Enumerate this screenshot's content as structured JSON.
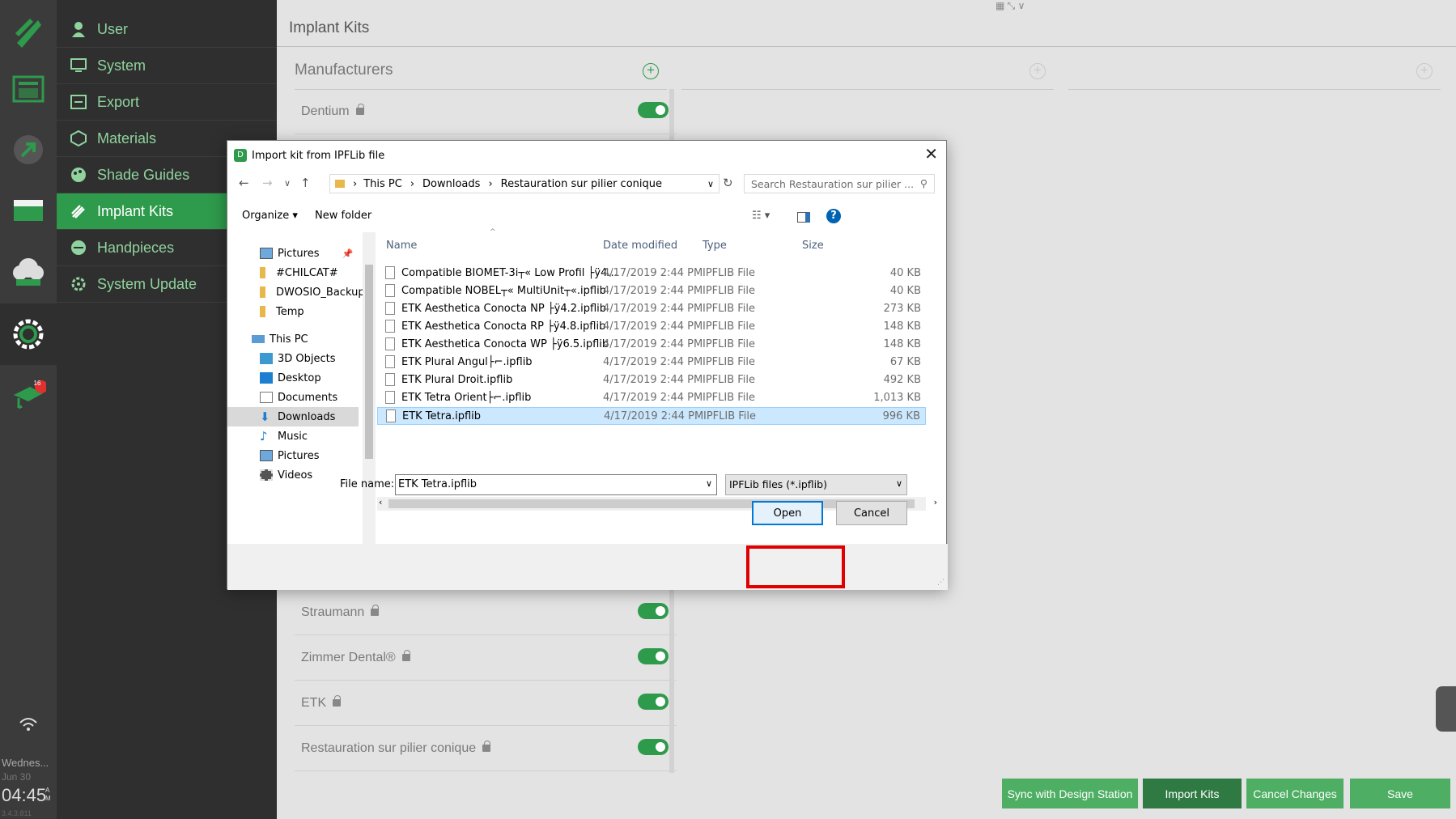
{
  "rail": {
    "day": "Wednes...",
    "date": "Jun 30",
    "time": "04:45",
    "ampm_a": "A",
    "ampm_m": "M",
    "version": "3.4.3.811",
    "badge": "16"
  },
  "nav": {
    "items": [
      {
        "label": "User",
        "icon": "user-icon"
      },
      {
        "label": "System",
        "icon": "monitor-icon"
      },
      {
        "label": "Export",
        "icon": "export-icon"
      },
      {
        "label": "Materials",
        "icon": "materials-icon"
      },
      {
        "label": "Shade Guides",
        "icon": "palette-icon"
      },
      {
        "label": "Implant Kits",
        "icon": "implant-icon",
        "active": true
      },
      {
        "label": "Handpieces",
        "icon": "handpiece-icon"
      },
      {
        "label": "System Update",
        "icon": "update-icon"
      }
    ]
  },
  "page": {
    "title": "Implant Kits",
    "manufacturers_header": "Manufacturers"
  },
  "manufacturers": [
    {
      "name": "Dentium",
      "enabled": true
    },
    {
      "name": "Straumann",
      "enabled": true
    },
    {
      "name": "Zimmer Dental®",
      "enabled": true
    },
    {
      "name": "ETK",
      "enabled": true
    },
    {
      "name": "Restauration sur pilier conique",
      "enabled": true
    }
  ],
  "buttons": {
    "sync": "Sync with Design Station",
    "import": "Import Kits",
    "cancel": "Cancel Changes",
    "save": "Save"
  },
  "dialog": {
    "title": "Import kit from IPFLib file",
    "path": [
      "This PC",
      "Downloads",
      "Restauration sur pilier conique"
    ],
    "search_placeholder": "Search Restauration sur pilier ...",
    "organize": "Organize",
    "new_folder": "New folder",
    "tree": [
      {
        "label": "Pictures",
        "type": "pictures",
        "pinned": true
      },
      {
        "label": "#CHILCAT#",
        "type": "folder"
      },
      {
        "label": "DWOSIO_Backup",
        "type": "folder"
      },
      {
        "label": "Temp",
        "type": "folder"
      },
      {
        "label": "This PC",
        "type": "pc"
      },
      {
        "label": "3D Objects",
        "type": "3d"
      },
      {
        "label": "Desktop",
        "type": "desktop"
      },
      {
        "label": "Documents",
        "type": "documents"
      },
      {
        "label": "Downloads",
        "type": "downloads",
        "selected": true
      },
      {
        "label": "Music",
        "type": "music"
      },
      {
        "label": "Pictures",
        "type": "pictures"
      },
      {
        "label": "Videos",
        "type": "videos"
      }
    ],
    "columns": [
      "Name",
      "Date modified",
      "Type",
      "Size"
    ],
    "files": [
      {
        "name": "Compatible BIOMET-3i┬« Low Profil ├ÿ4...",
        "date": "4/17/2019 2:44 PM",
        "type": "IPFLIB File",
        "size": "40 KB"
      },
      {
        "name": "Compatible NOBEL┬« MultiUnit┬«.ipflib",
        "date": "4/17/2019 2:44 PM",
        "type": "IPFLIB File",
        "size": "40 KB"
      },
      {
        "name": "ETK Aesthetica Conocta NP ├ÿ4.2.ipflib",
        "date": "4/17/2019 2:44 PM",
        "type": "IPFLIB File",
        "size": "273 KB"
      },
      {
        "name": "ETK Aesthetica Conocta RP ├ÿ4.8.ipflib",
        "date": "4/17/2019 2:44 PM",
        "type": "IPFLIB File",
        "size": "148 KB"
      },
      {
        "name": "ETK Aesthetica Conocta WP ├ÿ6.5.ipflib",
        "date": "4/17/2019 2:44 PM",
        "type": "IPFLIB File",
        "size": "148 KB"
      },
      {
        "name": "ETK Plural Angul├⌐.ipflib",
        "date": "4/17/2019 2:44 PM",
        "type": "IPFLIB File",
        "size": "67 KB"
      },
      {
        "name": "ETK Plural Droit.ipflib",
        "date": "4/17/2019 2:44 PM",
        "type": "IPFLIB File",
        "size": "492 KB"
      },
      {
        "name": "ETK Tetra Orient├⌐.ipflib",
        "date": "4/17/2019 2:44 PM",
        "type": "IPFLIB File",
        "size": "1,013 KB"
      },
      {
        "name": "ETK Tetra.ipflib",
        "date": "4/17/2019 2:44 PM",
        "type": "IPFLIB File",
        "size": "996 KB",
        "selected": true
      }
    ],
    "file_name_label": "File name:",
    "file_name_value": "ETK Tetra.ipflib",
    "file_type": "IPFLib files (*.ipflib)",
    "open": "Open",
    "cancel": "Cancel"
  },
  "colors": {
    "accent": "#2e9a4b",
    "nav_text": "#8fd39e",
    "rail_bg": "#3b3b3b",
    "highlight": "#e00000"
  }
}
